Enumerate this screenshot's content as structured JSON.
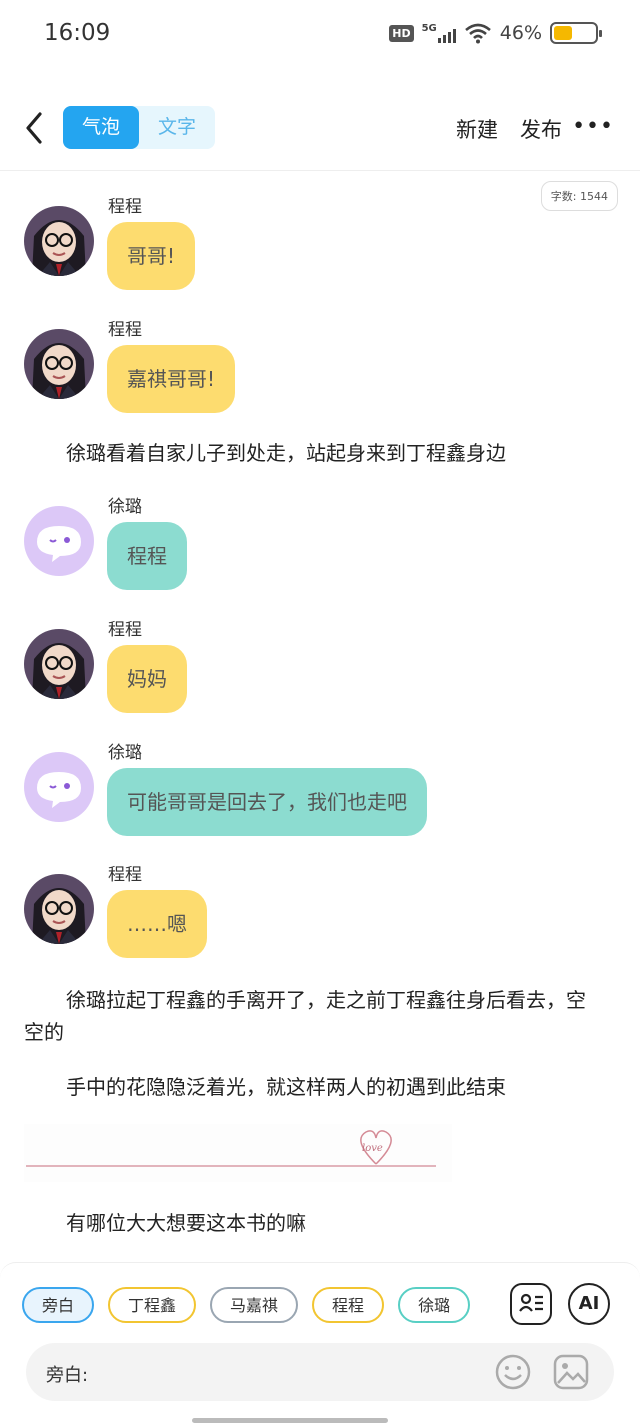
{
  "status": {
    "time": "16:09",
    "hd": "HD",
    "network": "5G",
    "battery": "46%"
  },
  "header": {
    "tabs": [
      {
        "label": "气泡"
      },
      {
        "label": "文字"
      }
    ],
    "new_label": "新建",
    "publish_label": "发布",
    "more_label": "•••"
  },
  "word_count": "字数: 1544",
  "messages": [
    {
      "speaker": "程程",
      "text": "哥哥!"
    },
    {
      "speaker": "程程",
      "text": "嘉祺哥哥!"
    },
    {
      "narration": "徐璐看着自家儿子到处走，站起身来到丁程鑫身边"
    },
    {
      "speaker": "徐璐",
      "text": "程程"
    },
    {
      "speaker": "程程",
      "text": "妈妈"
    },
    {
      "speaker": "徐璐",
      "text": "可能哥哥是回去了，我们也走吧"
    },
    {
      "speaker": "程程",
      "text": "……嗯"
    },
    {
      "narration": "徐璐拉起丁程鑫的手离开了，走之前丁程鑫往身后看去，空空的"
    },
    {
      "narration": "手中的花隐隐泛着光，就这样两人的初遇到此结束"
    },
    {
      "narration": "有哪位大大想要这本书的嘛"
    }
  ],
  "love_text": "love",
  "characters": [
    "旁白",
    "丁程鑫",
    "马嘉祺",
    "程程",
    "徐璐"
  ],
  "buttons": {
    "ai": "AI"
  },
  "input": {
    "label": "旁白:"
  },
  "colors": {
    "accent": "#24a5f0",
    "yellow_bubble": "#fddc6f",
    "teal_bubble": "#8cdcd0"
  }
}
